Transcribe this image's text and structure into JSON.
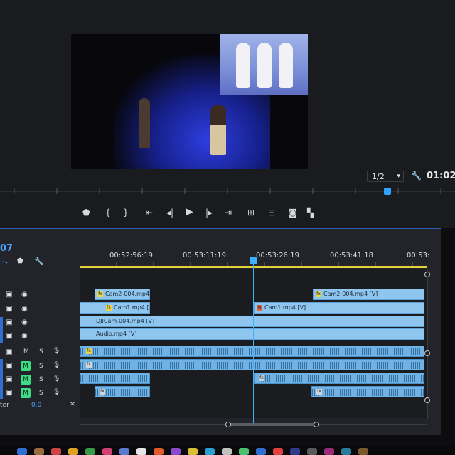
{
  "monitor": {
    "zoom_label": "1/2",
    "current_timecode": "01:02:"
  },
  "sequence": {
    "number": "07"
  },
  "timeline": {
    "ruler_timecodes": [
      "00:52:56:19",
      "00:53:11:19",
      "00:53:26:19",
      "00:53:41:18",
      "00:53:"
    ],
    "tracks": {
      "v3": {
        "clips": [
          {
            "label": "Cam2-004.mp4 [V]"
          },
          {
            "label": "Cam2-004.mp4 [V]"
          }
        ]
      },
      "v2": {
        "clips": [
          {
            "label": "Cam1.mp4 [V]"
          },
          {
            "label": "Cam1.mp4 [V]"
          }
        ]
      },
      "v1": {
        "clips": [
          {
            "label": "DJICam-004.mp4 [V]"
          }
        ]
      },
      "v0": {
        "clips": [
          {
            "label": "Audio.mp4 [V]"
          }
        ]
      }
    },
    "audio_header": {
      "mute": "M",
      "solo": "S"
    },
    "master": {
      "label": "ter",
      "value": "0.0"
    }
  },
  "colors": {
    "accent": "#2fa4ff",
    "video_clip": "#8fc6f0",
    "audio_clip": "#6fb3e6",
    "mute_active": "#3ddc84",
    "work_area": "#e2d23a"
  }
}
